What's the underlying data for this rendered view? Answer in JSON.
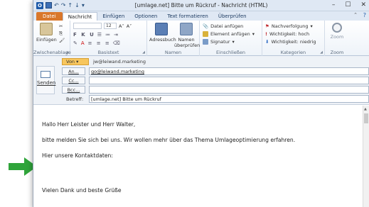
{
  "titlebar": {
    "title": "[umlage.net] Bitte um Rückruf - Nachricht (HTML)",
    "minimize": "–",
    "maximize": "☐",
    "close": "✕"
  },
  "tabs": [
    {
      "label": "Datei"
    },
    {
      "label": "Nachricht"
    },
    {
      "label": "Einfügen"
    },
    {
      "label": "Optionen"
    },
    {
      "label": "Text formatieren"
    },
    {
      "label": "Überprüfen"
    }
  ],
  "ribbon": {
    "clipboard": {
      "label": "Zwischenablage",
      "paste": "Einfügen"
    },
    "basictext": {
      "label": "Basistext",
      "fontsize": "12",
      "bold_italic": "F K U"
    },
    "names": {
      "label": "Namen",
      "addressbook": "Adressbuch",
      "check_names": "Namen überprüfen"
    },
    "include": {
      "label": "Einschließen",
      "attach_file": "Datei anfügen",
      "attach_item": "Element anfügen",
      "signature": "Signatur"
    },
    "tags": {
      "label": "Kategorien",
      "followup": "Nachverfolgung",
      "high": "Wichtigkeit: hoch",
      "low": "Wichtigkeit: niedrig"
    },
    "zoom": {
      "label": "Zoom",
      "zoom": "Zoom"
    }
  },
  "header": {
    "send_label": "Senden",
    "from_label": "Von ▾",
    "from_value": "jw@leiwand.marketing",
    "to_label": "An...",
    "to_value": "go@leiwand.marketing",
    "cc_label": "Cc...",
    "cc_value": "",
    "bcc_label": "Bcc...",
    "bcc_value": "",
    "subject_label": "Betreff:",
    "subject_value": "[umlage.net] Bitte um Rückruf"
  },
  "body": {
    "line1": "Hallo Herr Leister und Herr Walter,",
    "line2": "bitte melden Sie sich bei uns. Wir wollen mehr über das Thema Umlageoptimierung erfahren.",
    "line3": "Hier unsere Kontaktdaten:",
    "line4": "Vielen Dank und beste Grüße"
  },
  "colors": {
    "file_tab": "#d9772b",
    "arrow": "#2fa43a",
    "from_button": "#f7c65e"
  }
}
